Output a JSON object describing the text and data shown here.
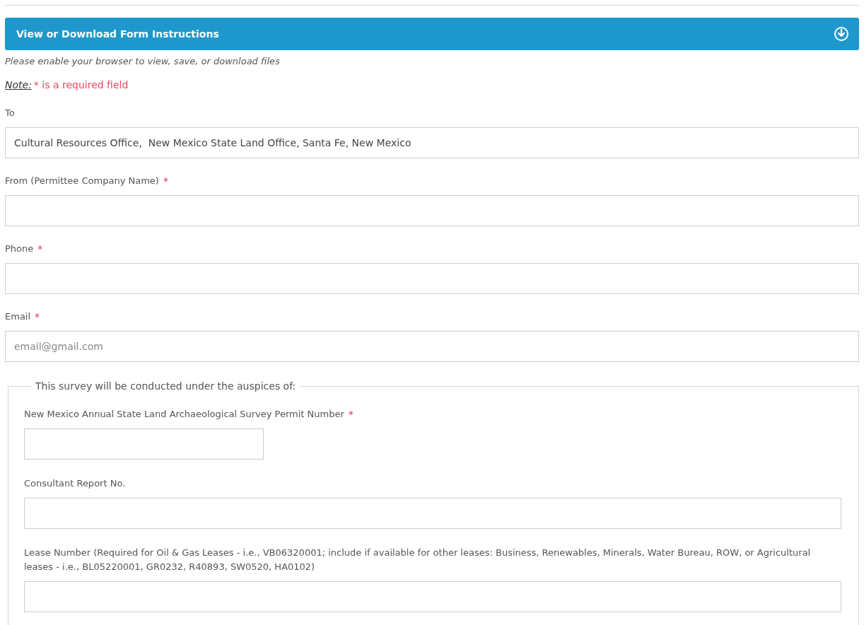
{
  "banner": {
    "title": "View or Download Form Instructions"
  },
  "browser_note": "Please enable your browser to view, save, or download files",
  "required_note": {
    "label": "Note:",
    "text": "* is a required field"
  },
  "fields": [
    {
      "label": "To",
      "value": "Cultural Resources Office,  New Mexico State Land Office, Santa Fe, New Mexico"
    },
    {
      "label": "From (Permittee Company Name)",
      "mark": "*"
    },
    {
      "label": "Phone",
      "mark": "*"
    },
    {
      "label": "Email",
      "mark": "*",
      "placeholder": "email@gmail.com"
    }
  ],
  "fieldset": {
    "legend": "This survey will be conducted under the auspices of:",
    "fields": [
      {
        "label": "New Mexico Annual State Land Archaeological Survey Permit Number",
        "mark": "*",
        "kind": "short"
      },
      {
        "label": "Consultant Report No.",
        "kind": "full"
      },
      {
        "label": "Lease Number (Required for Oil & Gas Leases - i.e., VB06320001; include if available for other leases: Business, Renewables, Minerals, Water Bureau, ROW, or Agricultural leases - i.e., BL05220001, GR0232, R40893, SW0520, HA0102)",
        "kind": "full"
      }
    ]
  }
}
